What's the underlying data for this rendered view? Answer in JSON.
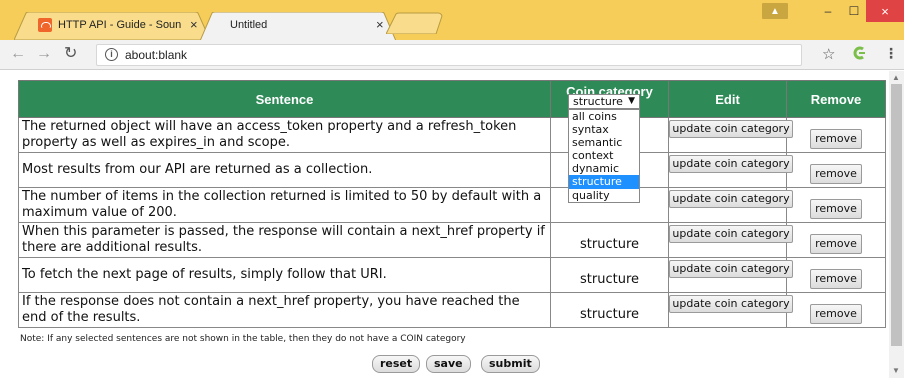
{
  "browser": {
    "tabs": [
      {
        "title": "HTTP API - Guide - Soun",
        "active": false
      },
      {
        "title": "Untitled",
        "active": true
      }
    ],
    "url": "about:blank",
    "tab_close_symbol": "×",
    "window_controls": {
      "user": "▲",
      "minimize": "–",
      "maximize": "☐",
      "close": "×"
    }
  },
  "table": {
    "headers": {
      "sentence": "Sentence",
      "category": "Coin category",
      "edit": "Edit",
      "remove": "Remove"
    },
    "header_select_value": "structure",
    "header_color": "#2e8b57",
    "rows": [
      {
        "sentence": "The returned object will have an access_token property and a refresh_token property as well as expires_in and scope.",
        "category": "",
        "edit_label": "update coin category",
        "remove_label": "remove"
      },
      {
        "sentence": "Most results from our API are returned as a collection.",
        "category": "",
        "edit_label": "update coin category",
        "remove_label": "remove"
      },
      {
        "sentence": "The number of items in the collection returned is limited to 50 by default with a maximum value of 200.",
        "category": "",
        "edit_label": "update coin category",
        "remove_label": "remove"
      },
      {
        "sentence": "When this parameter is passed, the response will contain a next_href property if there are additional results.",
        "category": "structure",
        "edit_label": "update coin category",
        "remove_label": "remove"
      },
      {
        "sentence": "To fetch the next page of results, simply follow that URI.",
        "category": "structure",
        "edit_label": "update coin category",
        "remove_label": "remove"
      },
      {
        "sentence": "If the response does not contain a next_href property, you have reached the end of the results.",
        "category": "structure",
        "edit_label": "update coin category",
        "remove_label": "remove"
      }
    ]
  },
  "dropdown": {
    "options": [
      "all coins",
      "syntax",
      "semantic",
      "context",
      "dynamic",
      "structure",
      "quality"
    ],
    "selected": "structure",
    "highlight_color": "#1e90ff"
  },
  "note": "Note: If any selected sentences are not shown in the table, then they do not have a COIN category",
  "form_buttons": {
    "reset": "reset",
    "save": "save",
    "submit": "submit"
  }
}
